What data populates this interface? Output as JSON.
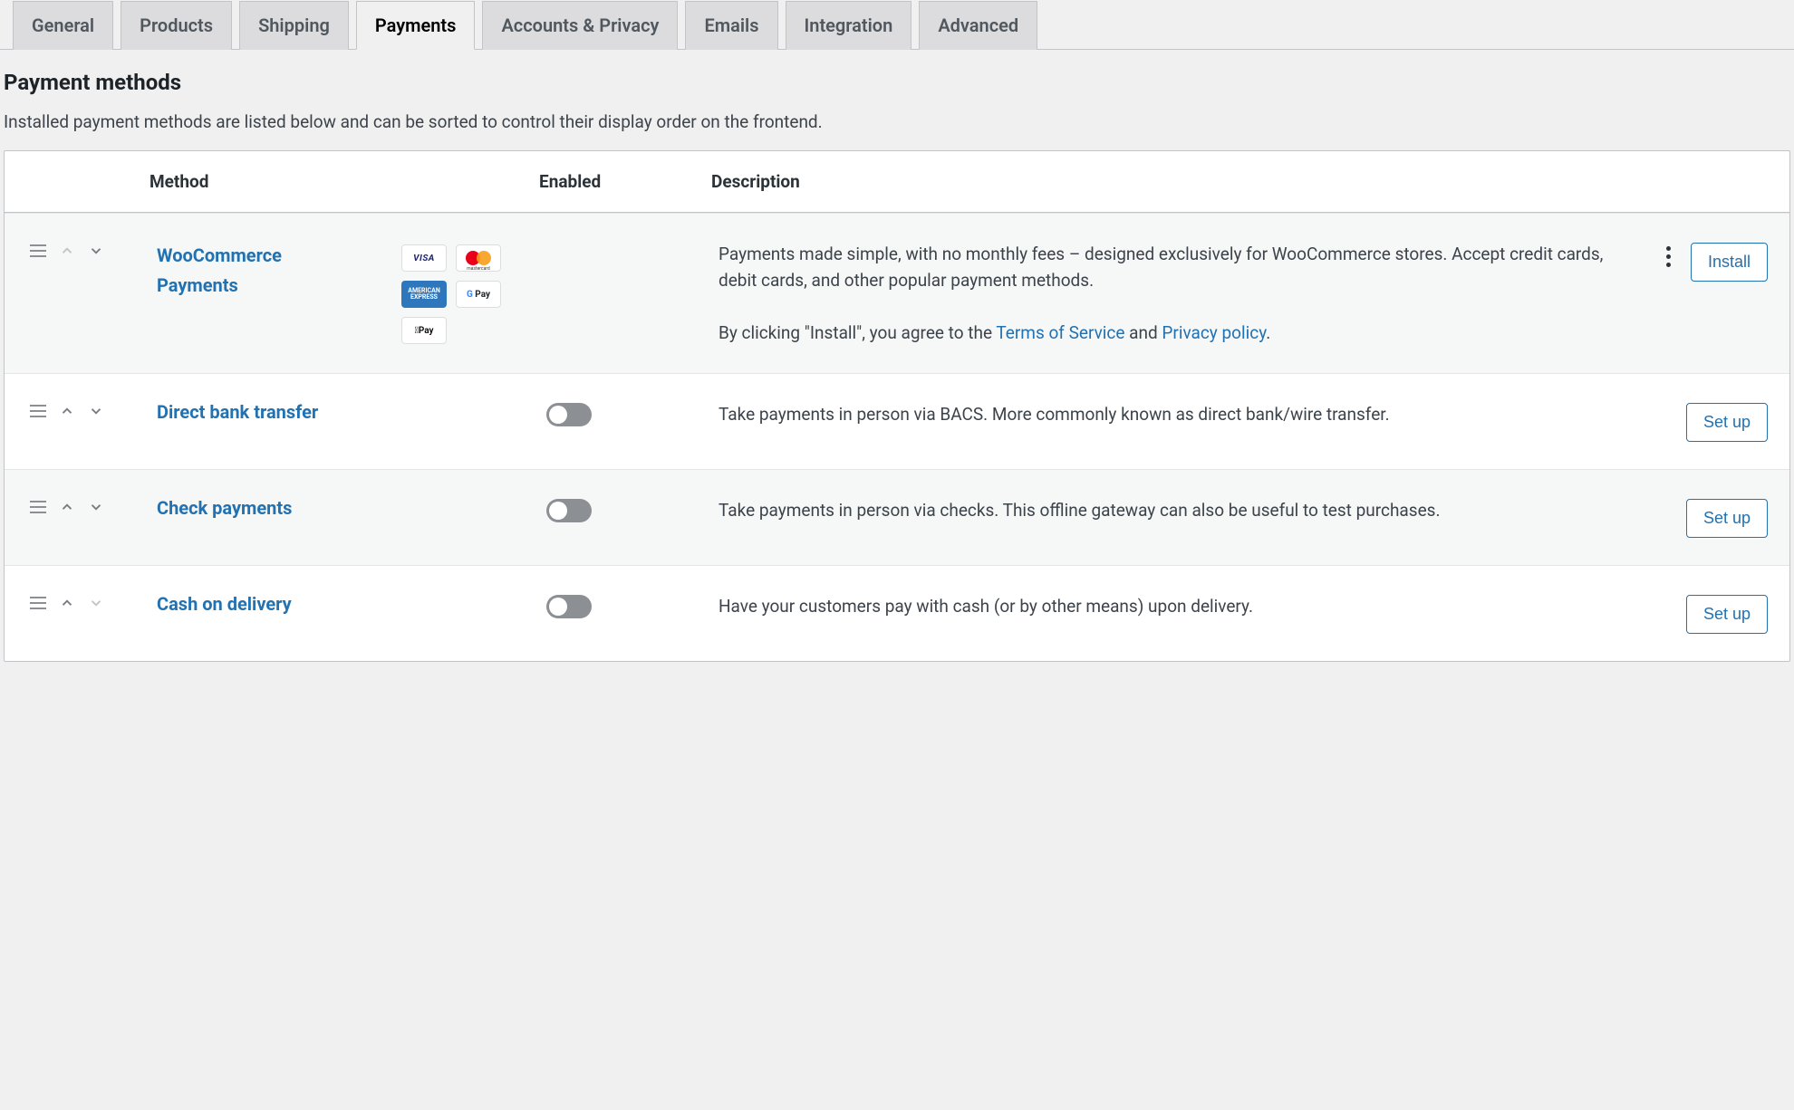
{
  "tabs": [
    {
      "label": "General"
    },
    {
      "label": "Products"
    },
    {
      "label": "Shipping"
    },
    {
      "label": "Payments",
      "active": true
    },
    {
      "label": "Accounts & Privacy"
    },
    {
      "label": "Emails"
    },
    {
      "label": "Integration"
    },
    {
      "label": "Advanced"
    }
  ],
  "section": {
    "title": "Payment methods",
    "description": "Installed payment methods are listed below and can be sorted to control their display order on the frontend."
  },
  "columns": {
    "method": "Method",
    "enabled": "Enabled",
    "description": "Description"
  },
  "badges": {
    "visa": "VISA",
    "mastercard": "mastercard",
    "amex_line1": "AMERICAN",
    "amex_line2": "EXPRESS",
    "gpay": "Pay",
    "applepay": "Pay"
  },
  "rows": [
    {
      "name": "WooCommerce Payments",
      "desc": "Payments made simple, with no monthly fees – designed exclusively for WooCommerce stores. Accept credit cards, debit cards, and other popular payment methods.",
      "agree_prefix": "By clicking \"Install\", you agree to the ",
      "tos": "Terms of Service",
      "and": " and ",
      "privacy": "Privacy policy",
      "period": ".",
      "action": "Install",
      "has_badges": true,
      "has_kebab": true,
      "has_toggle": false,
      "up_disabled": true,
      "down_disabled": false
    },
    {
      "name": "Direct bank transfer",
      "desc": "Take payments in person via BACS. More commonly known as direct bank/wire transfer.",
      "action": "Set up",
      "has_toggle": true,
      "up_disabled": false,
      "down_disabled": false
    },
    {
      "name": "Check payments",
      "desc": "Take payments in person via checks. This offline gateway can also be useful to test purchases.",
      "action": "Set up",
      "has_toggle": true,
      "up_disabled": false,
      "down_disabled": false
    },
    {
      "name": "Cash on delivery",
      "desc": "Have your customers pay with cash (or by other means) upon delivery.",
      "action": "Set up",
      "has_toggle": true,
      "up_disabled": false,
      "down_disabled": true
    }
  ]
}
